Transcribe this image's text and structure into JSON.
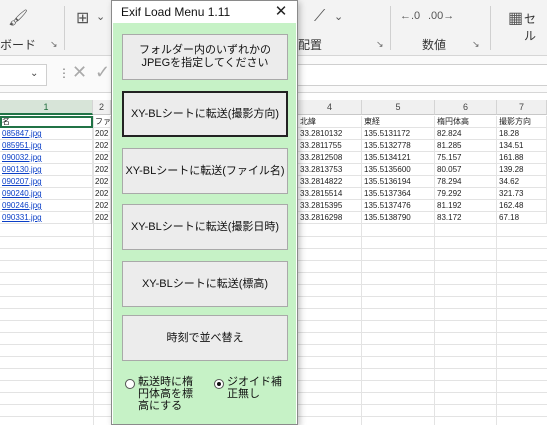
{
  "ribbon": {
    "clipboard_label": "ボード",
    "alignment_label": "配置",
    "number_label": "数値",
    "cell_styles_label": "セル",
    "launcher_glyph": "↘"
  },
  "formula_bar": {
    "cancel_glyph": "✕",
    "enter_glyph": "✓",
    "dots": "⋮",
    "namebox_caret": "⌄"
  },
  "sheet": {
    "columns": [
      "1",
      "2",
      "3",
      "4",
      "5",
      "6",
      "7"
    ],
    "left_header_partial": "名",
    "col2_header_partial": "ファ",
    "header_row": {
      "c4": "北緯",
      "c5": "東経",
      "c6": "楕円体高",
      "c7": "撮影方向"
    },
    "rows": [
      {
        "file": "085847.jpg",
        "c2": "202",
        "lat": "33.2810132",
        "lon": "135.5131172",
        "h": "82.824",
        "dir": "18.28"
      },
      {
        "file": "085951.jpg",
        "c2": "202",
        "lat": "33.2811755",
        "lon": "135.5132778",
        "h": "81.285",
        "dir": "134.51"
      },
      {
        "file": "090032.jpg",
        "c2": "202",
        "lat": "33.2812508",
        "lon": "135.5134121",
        "h": "75.157",
        "dir": "161.88"
      },
      {
        "file": "090130.jpg",
        "c2": "202",
        "lat": "33.2813753",
        "lon": "135.5135600",
        "h": "80.057",
        "dir": "139.28"
      },
      {
        "file": "090207.jpg",
        "c2": "202",
        "lat": "33.2814822",
        "lon": "135.5136194",
        "h": "78.294",
        "dir": "34.62"
      },
      {
        "file": "090240.jpg",
        "c2": "202",
        "lat": "33.2815514",
        "lon": "135.5137364",
        "h": "79.292",
        "dir": "321.73"
      },
      {
        "file": "090246.jpg",
        "c2": "202",
        "lat": "33.2815395",
        "lon": "135.5137476",
        "h": "81.192",
        "dir": "162.48"
      },
      {
        "file": "090331.jpg",
        "c2": "202",
        "lat": "33.2816298",
        "lon": "135.5138790",
        "h": "83.172",
        "dir": "67.18"
      }
    ]
  },
  "dialog": {
    "title": "Exif Load Menu 1.11",
    "close_glyph": "✕",
    "buttons": {
      "select_folder": "フォルダー内のいずれかの\nJPEGを指定してください",
      "xy_direction": "XY-BLシートに転送(撮影方向)",
      "xy_filename": "XY-BLシートに転送(ファイル名)",
      "xy_datetime": "XY-BLシートに転送(撮影日時)",
      "xy_elevation": "XY-BLシートに転送(標高)",
      "sort_time": "時刻で並べ替え"
    },
    "radios": {
      "ellipsoid_label": "転送時に楕\n円体高を標\n高にする",
      "ellipsoid_checked": false,
      "no_geoid_label": "ジオイド補\n正無し",
      "no_geoid_checked": true
    }
  }
}
